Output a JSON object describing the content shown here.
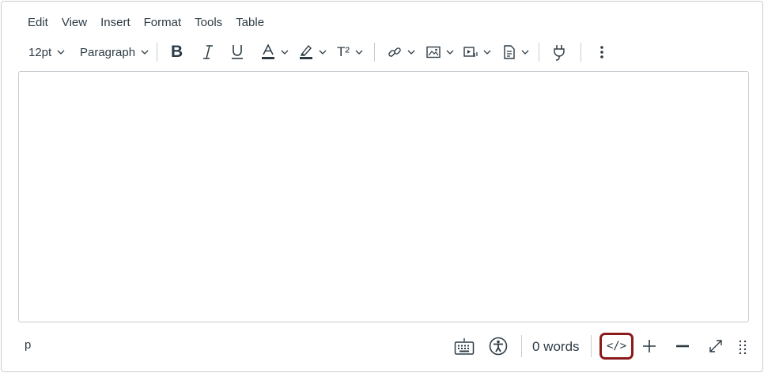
{
  "menubar": {
    "items": [
      "Edit",
      "View",
      "Insert",
      "Format",
      "Tools",
      "Table"
    ]
  },
  "toolbar": {
    "font_size": "12pt",
    "block_format": "Paragraph",
    "bold_label": "B",
    "superscript_label": "T²"
  },
  "status": {
    "path": "p",
    "word_count": "0 words",
    "html_editor_label": "</>"
  },
  "colors": {
    "text": "#2d3b45",
    "border": "#c7cdd1",
    "highlight_ring": "#8b1a1a"
  }
}
